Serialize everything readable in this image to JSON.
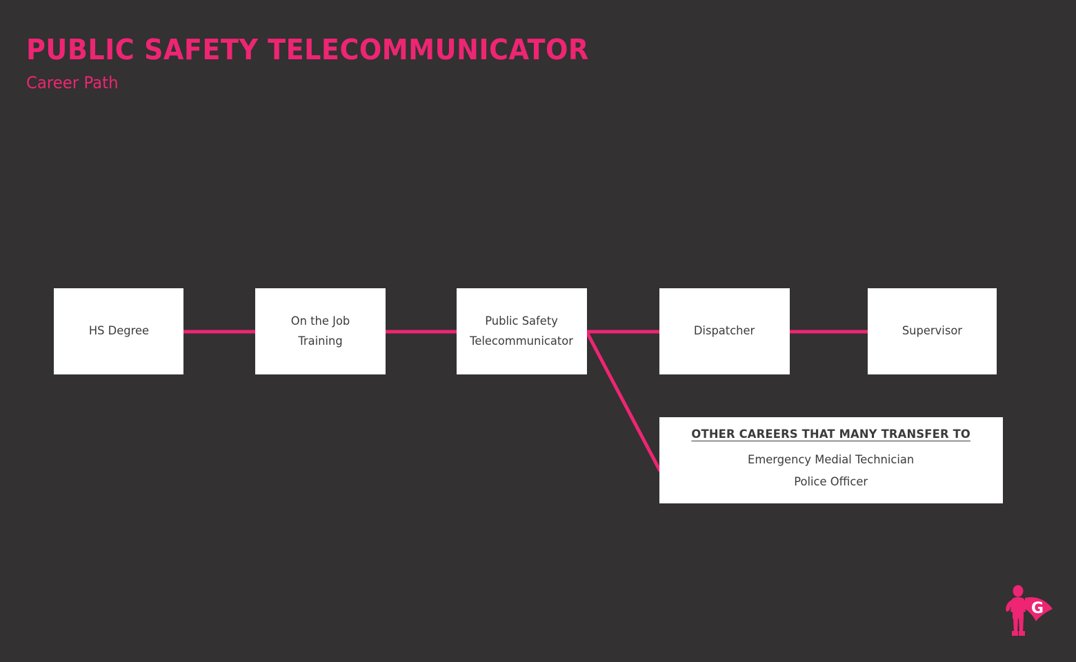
{
  "header": {
    "title": "PUBLIC SAFETY TELECOMMUNICATOR",
    "subtitle": "Career Path"
  },
  "colors": {
    "background": "#333131",
    "accent_pink": "#ee2573",
    "box_background": "#ffffff",
    "box_text": "#3b3b3b"
  },
  "flow": {
    "steps": [
      {
        "id": "hs-degree",
        "label": "HS Degree"
      },
      {
        "id": "ojt",
        "label": "On the Job\nTraining",
        "line1": "On the Job",
        "line2": "Training"
      },
      {
        "id": "pst",
        "label": "Public Safety\nTelecommunicator",
        "line1": "Public Safety",
        "line2": "Telecommunicator"
      },
      {
        "id": "dispatcher",
        "label": "Dispatcher"
      },
      {
        "id": "supervisor",
        "label": "Supervisor"
      }
    ]
  },
  "other_careers": {
    "heading": "OTHER CAREERS THAT MANY TRANSFER TO",
    "items": [
      "Emergency Medial Technician",
      "Police Officer"
    ]
  },
  "logo": {
    "name": "superhero-g-logo",
    "letter": "G"
  }
}
